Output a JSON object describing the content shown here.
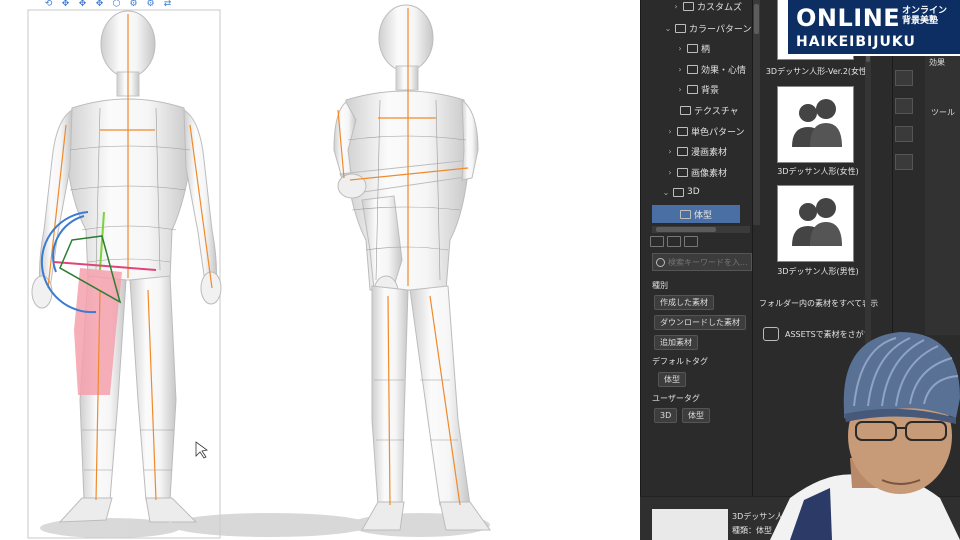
{
  "canvas": {
    "toolbar_icons": [
      "rotate-icon",
      "move-icon",
      "move-icon",
      "move-icon",
      "cube-icon",
      "gear-icon",
      "gear-icon",
      "link-icon"
    ]
  },
  "tree": {
    "items": [
      {
        "label": "カスタムズ",
        "expanded": false
      },
      {
        "label": "カラーパターン",
        "expanded": true
      },
      {
        "label": "柄",
        "expanded": false
      },
      {
        "label": "効果・心情",
        "expanded": false
      },
      {
        "label": "背景",
        "expanded": false
      },
      {
        "label": "テクスチャ",
        "expanded": false
      },
      {
        "label": "単色パターン",
        "expanded": false
      },
      {
        "label": "漫画素材",
        "expanded": false
      },
      {
        "label": "画像素材",
        "expanded": false
      },
      {
        "label": "3D",
        "expanded": true
      },
      {
        "label": "体型",
        "selected": true
      }
    ]
  },
  "search": {
    "placeholder": "検索キーワードを入..."
  },
  "filters": {
    "kind_label": "種別",
    "kind_tags": [
      "作成した素材",
      "ダウンロードした素材",
      "追加素材"
    ],
    "default_tag_label": "デフォルトタグ",
    "default_tags": [
      "体型"
    ],
    "user_tag_label": "ユーザータグ",
    "user_tags": [
      "3D",
      "体型"
    ]
  },
  "materials": {
    "items": [
      {
        "label": "3Dデッサン人形-Ver.2(女性)"
      },
      {
        "label": "3Dデッサン人形(女性)"
      },
      {
        "label": "3Dデッサン人形(男性)"
      }
    ],
    "show_all_label": "フォルダー内の素材をすべて表示",
    "assets_label": "ASSETSで素材をさがす"
  },
  "properties": {
    "effect_label": "効果",
    "tool_label": "ツール"
  },
  "bottom": {
    "name": "3Dデッサン人形",
    "kind": "種類：体型"
  },
  "logo": {
    "main": "ONLINE",
    "jp_top": "オンライン",
    "jp_bottom": "背景美塾",
    "sub": "HAIKEIBIJUKU"
  },
  "colors": {
    "panel_bg": "#2b2b2b",
    "selection": "#4a6fa5",
    "logo_bg": "#0d2e63",
    "guide_line": "#f08a2a",
    "selected_part": "#f4a0ac"
  }
}
